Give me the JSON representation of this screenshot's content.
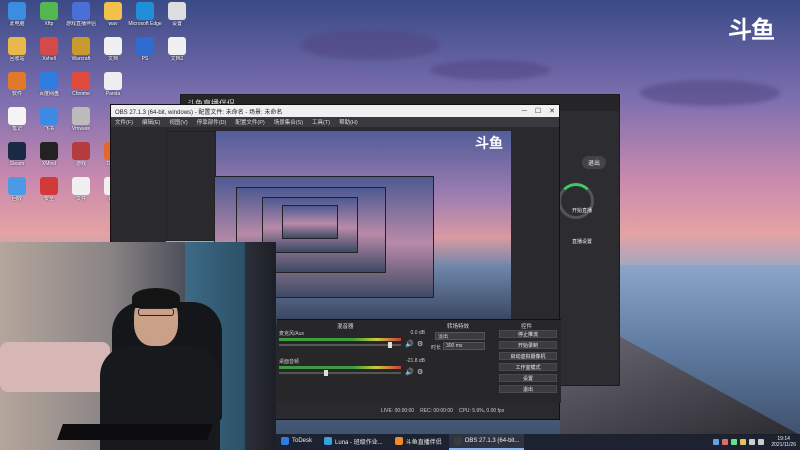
{
  "watermark": "斗鱼",
  "desktop_icons": [
    {
      "label": "此电脑",
      "color": "#3a8de0",
      "col": 0,
      "row": 0
    },
    {
      "label": "Xftp",
      "color": "#53b84f",
      "col": 1,
      "row": 0
    },
    {
      "label": "游戏直播伴侣",
      "color": "#4a6fd6",
      "col": 2,
      "row": 0
    },
    {
      "label": "wav",
      "color": "#f1c14a",
      "col": 3,
      "row": 0
    },
    {
      "label": "Microsoft Edge",
      "color": "#1e8fd8",
      "col": 4,
      "row": 0
    },
    {
      "label": "设置",
      "color": "#dddddd",
      "col": 5,
      "row": 0
    },
    {
      "label": "回收站",
      "color": "#e9b84c",
      "col": 0,
      "row": 1
    },
    {
      "label": "Xshell",
      "color": "#d44a4a",
      "col": 1,
      "row": 1
    },
    {
      "label": "Warcraft",
      "color": "#c99a2e",
      "col": 2,
      "row": 1
    },
    {
      "label": "文档",
      "color": "#f0f0f0",
      "col": 3,
      "row": 1
    },
    {
      "label": "PS",
      "color": "#2e6dcf",
      "col": 4,
      "row": 1
    },
    {
      "label": "文档2",
      "color": "#f0f0f0",
      "col": 5,
      "row": 1
    },
    {
      "label": "软件",
      "color": "#e07a2a",
      "col": 0,
      "row": 2
    },
    {
      "label": "百度网盘",
      "color": "#2f7de0",
      "col": 1,
      "row": 2
    },
    {
      "label": "Chrome",
      "color": "#e14b3b",
      "col": 2,
      "row": 2
    },
    {
      "label": "Panda",
      "color": "#eeeeee",
      "col": 3,
      "row": 2
    },
    {
      "label": "笔记",
      "color": "#f4f4f4",
      "col": 0,
      "row": 3
    },
    {
      "label": "飞书",
      "color": "#3c8ae6",
      "col": 1,
      "row": 3
    },
    {
      "label": "Vmware",
      "color": "#bbbbbb",
      "col": 2,
      "row": 3
    },
    {
      "label": "Steam",
      "color": "#1a2a44",
      "col": 0,
      "row": 4
    },
    {
      "label": "XMind",
      "color": "#222222",
      "col": 1,
      "row": 4
    },
    {
      "label": "游戏",
      "color": "#b53c3c",
      "col": 2,
      "row": 4
    },
    {
      "label": "Office",
      "color": "#e2682b",
      "col": 3,
      "row": 4
    },
    {
      "label": "回收",
      "color": "#4a9ae8",
      "col": 0,
      "row": 5
    },
    {
      "label": "安全",
      "color": "#d23a3a",
      "col": 1,
      "row": 5
    },
    {
      "label": "文件",
      "color": "#f0f0f0",
      "col": 2,
      "row": 5
    },
    {
      "label": "记录",
      "color": "#f0f0f0",
      "col": 3,
      "row": 5
    }
  ],
  "douyu_app": {
    "title": "斗鱼直播伴侣",
    "exit_label": "退出",
    "start_label": "开始直播",
    "side_label": "直播设置"
  },
  "obs": {
    "title": "OBS 27.1.3 (64-bit, windows) - 配置文件: 未命名 - 场景: 未命名",
    "menu": [
      "文件(F)",
      "编辑(E)",
      "视图(V)",
      "停靠部件(D)",
      "配置文件(P)",
      "场景集合(S)",
      "工具(T)",
      "帮助(H)"
    ],
    "preview_logo": "斗鱼",
    "mixer_title": "混音器",
    "transition_title": "转场特效",
    "controls_title": "控件",
    "mixer_rows": [
      {
        "name": "麦克风/Aux",
        "db": "0.0 dB",
        "level": 0.92
      },
      {
        "name": "桌面音频",
        "db": "-21.8 dB",
        "level": 0.38
      }
    ],
    "transition_value": "淡出",
    "duration_label": "时长",
    "duration_value": "300 ms",
    "control_buttons": [
      "停止推流",
      "开始录制",
      "启动虚拟摄像机",
      "工作室模式",
      "设置",
      "退出"
    ],
    "status": {
      "live": "LIVE: 00:00:00",
      "rec": "REC: 00:00:00",
      "cpu": "CPU: 5.9%, 0.00 fps"
    }
  },
  "taskbar": {
    "tasks": [
      {
        "label": "ToDesk",
        "color": "#2f7de0",
        "active": false
      },
      {
        "label": "Luna - 班级作业...",
        "color": "#3aa0e0",
        "active": false
      },
      {
        "label": "斗鱼直播伴侣",
        "color": "#f08a2a",
        "active": false
      },
      {
        "label": "OBS 27.1.3 (64-bit...",
        "color": "#3c3c3c",
        "active": true
      }
    ],
    "time": "19:14",
    "date": "2021/11/26"
  }
}
